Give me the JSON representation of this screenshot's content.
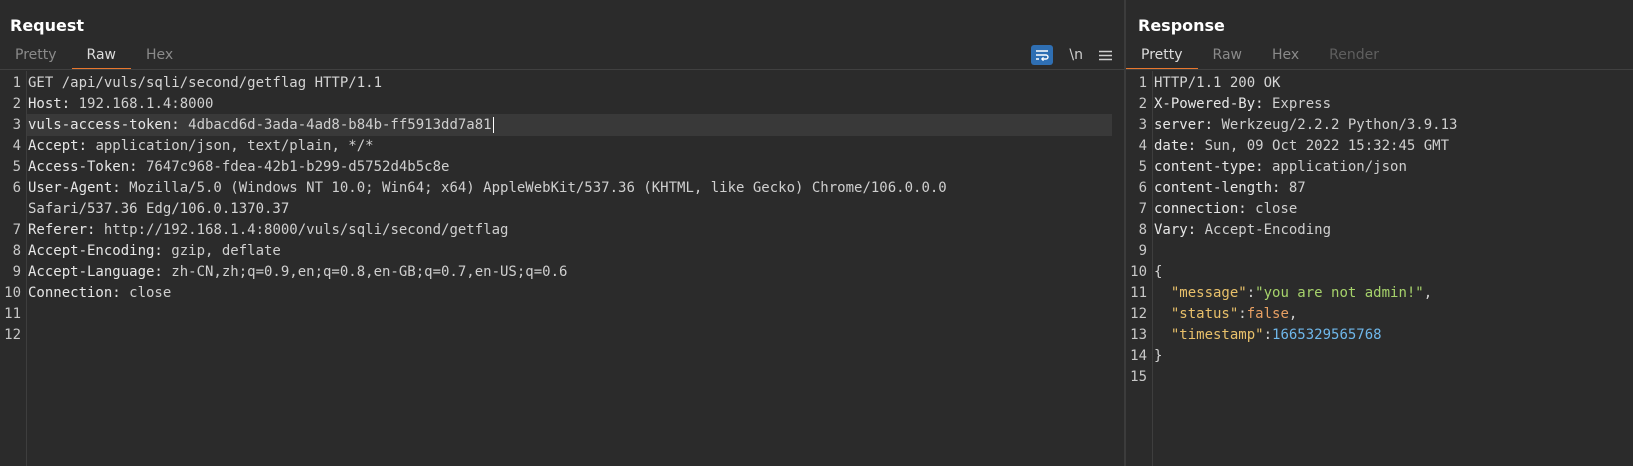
{
  "request": {
    "title": "Request",
    "tabs": [
      {
        "label": "Pretty",
        "state": "normal"
      },
      {
        "label": "Raw",
        "state": "active"
      },
      {
        "label": "Hex",
        "state": "normal"
      }
    ],
    "tools": {
      "wrap_icon": "wrap-lines-icon",
      "newline_label": "\\n",
      "menu_icon": "hamburger-menu-icon"
    },
    "lines": [
      {
        "n": "1",
        "plain": "GET /api/vuls/sqli/second/getflag HTTP/1.1"
      },
      {
        "n": "2",
        "key": "Host:",
        "value": " 192.168.1.4:8000"
      },
      {
        "n": "3",
        "key": "vuls-access-token:",
        "value": " 4dbacd6d-3ada-4ad8-b84b-ff5913dd7a81"
      },
      {
        "n": "4",
        "key": "Accept:",
        "value": " application/json, text/plain, */*"
      },
      {
        "n": "5",
        "key": "Access-Token:",
        "value": " 7647c968-fdea-42b1-b299-d5752d4b5c8e"
      },
      {
        "n": "6",
        "key": "User-Agent:",
        "value": " Mozilla/5.0 (Windows NT 10.0; Win64; x64) AppleWebKit/537.36 (KHTML, like Gecko) Chrome/106.0.0.0"
      },
      {
        "n": "",
        "plain": "Safari/537.36 Edg/106.0.1370.37"
      },
      {
        "n": "7",
        "key": "Referer:",
        "value": " http://192.168.1.4:8000/vuls/sqli/second/getflag"
      },
      {
        "n": "8",
        "key": "Accept-Encoding:",
        "value": " gzip, deflate"
      },
      {
        "n": "9",
        "key": "Accept-Language:",
        "value": " zh-CN,zh;q=0.9,en;q=0.8,en-GB;q=0.7,en-US;q=0.6"
      },
      {
        "n": "10",
        "key": "Connection:",
        "value": " close"
      },
      {
        "n": "11",
        "plain": ""
      },
      {
        "n": "12",
        "plain": ""
      }
    ]
  },
  "response": {
    "title": "Response",
    "tabs": [
      {
        "label": "Pretty",
        "state": "active"
      },
      {
        "label": "Raw",
        "state": "normal"
      },
      {
        "label": "Hex",
        "state": "normal"
      },
      {
        "label": "Render",
        "state": "disabled"
      }
    ],
    "lines": [
      {
        "n": "1",
        "plain": "HTTP/1.1 200 OK"
      },
      {
        "n": "2",
        "key": "X-Powered-By:",
        "value": " Express"
      },
      {
        "n": "3",
        "key": "server:",
        "value": " Werkzeug/2.2.2 Python/3.9.13"
      },
      {
        "n": "4",
        "key": "date:",
        "value": " Sun, 09 Oct 2022 15:32:45 GMT"
      },
      {
        "n": "5",
        "key": "content-type:",
        "value": " application/json"
      },
      {
        "n": "6",
        "key": "content-length:",
        "value": " 87"
      },
      {
        "n": "7",
        "key": "connection:",
        "value": " close"
      },
      {
        "n": "8",
        "key": "Vary:",
        "value": " Accept-Encoding"
      },
      {
        "n": "9",
        "plain": ""
      },
      {
        "n": "10",
        "plain": "{"
      },
      {
        "n": "11",
        "json": [
          [
            "  ",
            "p"
          ],
          [
            "\"message\"",
            "k"
          ],
          [
            ":",
            "p"
          ],
          [
            "\"you are not admin!\"",
            "s"
          ],
          [
            ",",
            "p"
          ]
        ]
      },
      {
        "n": "12",
        "json": [
          [
            "  ",
            "p"
          ],
          [
            "\"status\"",
            "k"
          ],
          [
            ":",
            "p"
          ],
          [
            "false",
            "b"
          ],
          [
            ",",
            "p"
          ]
        ]
      },
      {
        "n": "13",
        "json": [
          [
            "  ",
            "p"
          ],
          [
            "\"timestamp\"",
            "k"
          ],
          [
            ":",
            "p"
          ],
          [
            "1665329565768",
            "n"
          ]
        ]
      },
      {
        "n": "14",
        "plain": "}"
      },
      {
        "n": "15",
        "plain": ""
      }
    ]
  },
  "colors": {
    "accent": "#e8772e",
    "background": "#2b2b2b",
    "wrap_button": "#2f6fb3",
    "json_key": "#e8c06a",
    "json_string": "#a6d26b",
    "json_bool": "#e8a063",
    "json_number": "#6fb7ea"
  }
}
